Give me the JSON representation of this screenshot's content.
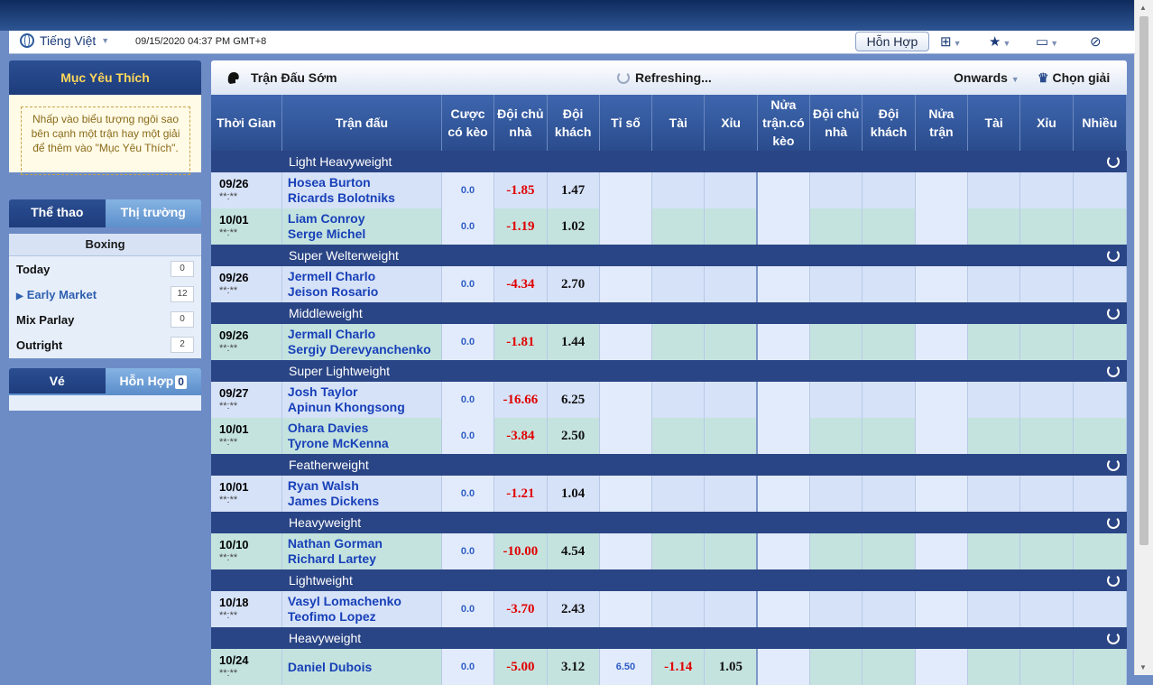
{
  "header": {
    "language": "Tiếng Việt",
    "datetime": "09/15/2020 04:37 PM GMT+8",
    "mode_button": "Hỗn Hợp"
  },
  "sidebar": {
    "favorites_title": "Mục Yêu Thích",
    "favorites_hint": "Nhấp vào biểu tượng ngôi sao bên cạnh một trận hay một giải để thêm vào \"Mục Yêu Thích\".",
    "tab_sports": "Thể thao",
    "tab_markets": "Thị trường",
    "sport_title": "Boxing",
    "markets": [
      {
        "label": "Today",
        "count": "0"
      },
      {
        "label": "Early Market",
        "count": "12"
      },
      {
        "label": "Mix Parlay",
        "count": "0"
      },
      {
        "label": "Outright",
        "count": "2"
      }
    ],
    "tab_ticket": "Vé",
    "tab_mixed": "Hỗn Hợp",
    "mixed_count": "0"
  },
  "main": {
    "title": "Trận Đấu Sớm",
    "refreshing": "Refreshing...",
    "onwards": "Onwards",
    "select_league": "Chọn giải",
    "columns": {
      "time": "Thời Gian",
      "match": "Trận đấu",
      "hdp": "Cược có kèo",
      "home": "Đội chủ nhà",
      "away": "Đội khách",
      "score": "Tỉ số",
      "over": "Tài",
      "under": "Xỉu",
      "half_hdp": "Nửa trận.có kèo",
      "half_home": "Đội chủ nhà",
      "half_away": "Đội khách",
      "half": "Nửa trận",
      "half_over": "Tài",
      "half_under": "Xỉu",
      "more": "Nhiều"
    },
    "groups": [
      {
        "category": "Light Heavyweight",
        "matches": [
          {
            "date": "09/26",
            "time": "**:**",
            "home": "Hosea Burton",
            "away": "Ricards Bolotniks",
            "hdp": "0.0",
            "home_odds": "-1.85",
            "away_odds": "1.47"
          },
          {
            "date": "10/01",
            "time": "**:**",
            "home": "Liam Conroy",
            "away": "Serge Michel",
            "hdp": "0.0",
            "home_odds": "-1.19",
            "away_odds": "1.02"
          }
        ]
      },
      {
        "category": "Super Welterweight",
        "matches": [
          {
            "date": "09/26",
            "time": "**:**",
            "home": "Jermell Charlo",
            "away": "Jeison Rosario",
            "hdp": "0.0",
            "home_odds": "-4.34",
            "away_odds": "2.70"
          }
        ]
      },
      {
        "category": "Middleweight",
        "matches": [
          {
            "date": "09/26",
            "time": "**:**",
            "home": "Jermall Charlo",
            "away": "Sergiy Derevyanchenko",
            "hdp": "0.0",
            "home_odds": "-1.81",
            "away_odds": "1.44"
          }
        ]
      },
      {
        "category": "Super Lightweight",
        "matches": [
          {
            "date": "09/27",
            "time": "**:**",
            "home": "Josh Taylor",
            "away": "Apinun Khongsong",
            "hdp": "0.0",
            "home_odds": "-16.66",
            "away_odds": "6.25"
          },
          {
            "date": "10/01",
            "time": "**:**",
            "home": "Ohara Davies",
            "away": "Tyrone McKenna",
            "hdp": "0.0",
            "home_odds": "-3.84",
            "away_odds": "2.50"
          }
        ]
      },
      {
        "category": "Featherweight",
        "matches": [
          {
            "date": "10/01",
            "time": "**:**",
            "home": "Ryan Walsh",
            "away": "James Dickens",
            "hdp": "0.0",
            "home_odds": "-1.21",
            "away_odds": "1.04"
          }
        ]
      },
      {
        "category": "Heavyweight",
        "matches": [
          {
            "date": "10/10",
            "time": "**:**",
            "home": "Nathan Gorman",
            "away": "Richard Lartey",
            "hdp": "0.0",
            "home_odds": "-10.00",
            "away_odds": "4.54"
          }
        ]
      },
      {
        "category": "Lightweight",
        "matches": [
          {
            "date": "10/18",
            "time": "**:**",
            "home": "Vasyl Lomachenko",
            "away": "Teofimo Lopez",
            "hdp": "0.0",
            "home_odds": "-3.70",
            "away_odds": "2.43"
          }
        ]
      },
      {
        "category": "Heavyweight",
        "matches": [
          {
            "date": "10/24",
            "time": "**:**",
            "home": "Daniel Dubois",
            "away": "",
            "hdp": "0.0",
            "home_odds": "-5.00",
            "away_odds": "3.12",
            "score": "6.50",
            "over": "-1.14",
            "under": "1.05"
          }
        ]
      }
    ]
  }
}
